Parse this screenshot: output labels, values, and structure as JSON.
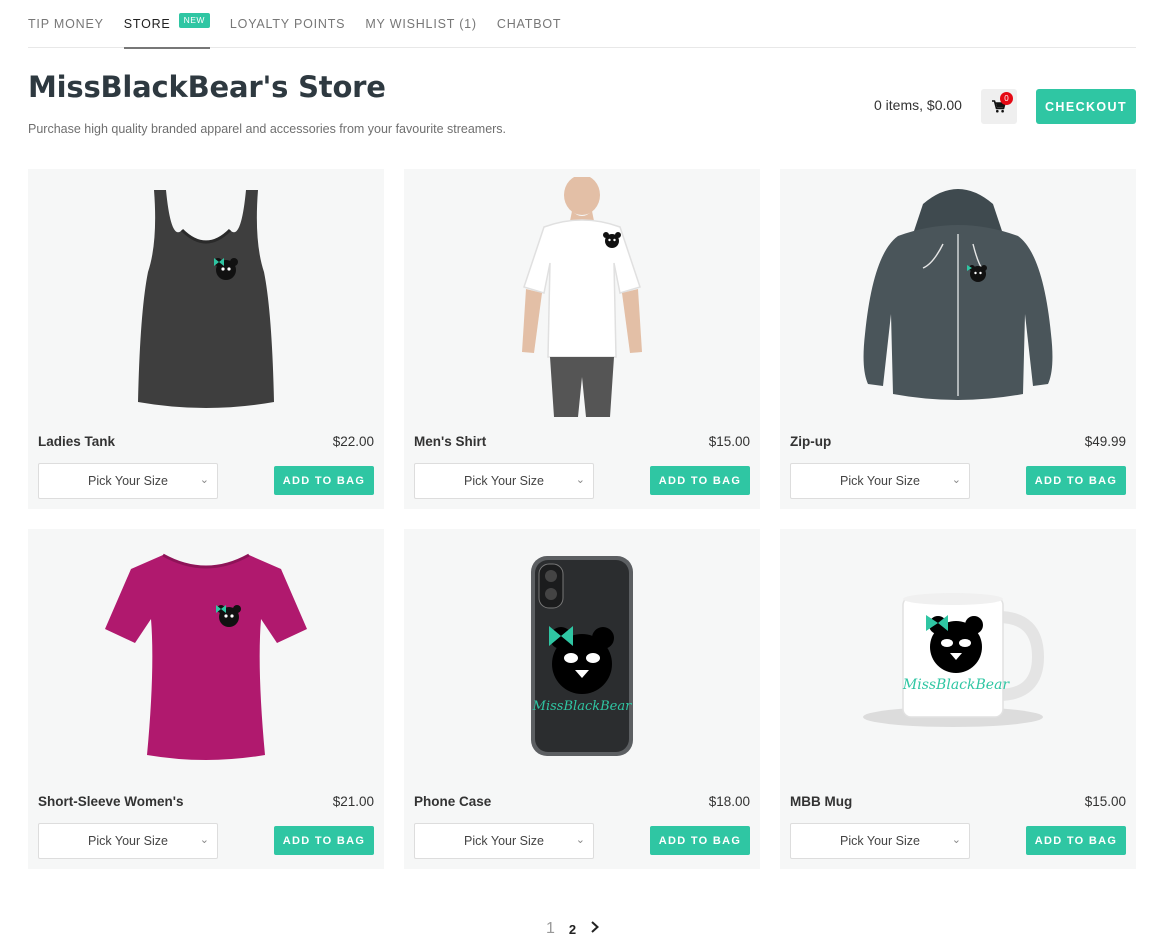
{
  "tabs": [
    {
      "label": "TIP MONEY"
    },
    {
      "label": "STORE",
      "badge": "NEW"
    },
    {
      "label": "LOYALTY POINTS"
    },
    {
      "label": "MY WISHLIST (1)"
    },
    {
      "label": "CHATBOT"
    }
  ],
  "header": {
    "title": "MissBlackBear's Store",
    "subtitle": "Purchase high quality branded apparel and accessories from your favourite streamers.",
    "cart_summary": "0 items, $0.00",
    "cart_count": "0",
    "checkout_label": "CHECKOUT"
  },
  "products": [
    {
      "name": "Ladies Tank",
      "price": "$22.00",
      "size_placeholder": "Pick Your Size",
      "add_label": "ADD TO BAG",
      "image": "tank-top"
    },
    {
      "name": "Men's Shirt",
      "price": "$15.00",
      "size_placeholder": "Pick Your Size",
      "add_label": "ADD TO BAG",
      "image": "mens-shirt"
    },
    {
      "name": "Zip-up",
      "price": "$49.99",
      "size_placeholder": "Pick Your Size",
      "add_label": "ADD TO BAG",
      "image": "hoodie"
    },
    {
      "name": "Short-Sleeve Women's",
      "price": "$21.00",
      "size_placeholder": "Pick Your Size",
      "add_label": "ADD TO BAG",
      "image": "womens-tee"
    },
    {
      "name": "Phone Case",
      "price": "$18.00",
      "size_placeholder": "Pick Your Size",
      "add_label": "ADD TO BAG",
      "image": "phone-case"
    },
    {
      "name": "MBB Mug",
      "price": "$15.00",
      "size_placeholder": "Pick Your Size",
      "add_label": "ADD TO BAG",
      "image": "mug"
    }
  ],
  "pagination": {
    "current": "1",
    "next_page": "2"
  },
  "colors": {
    "accent": "#2fc6a3",
    "badge_red": "#e50914",
    "title": "#2e3940"
  }
}
